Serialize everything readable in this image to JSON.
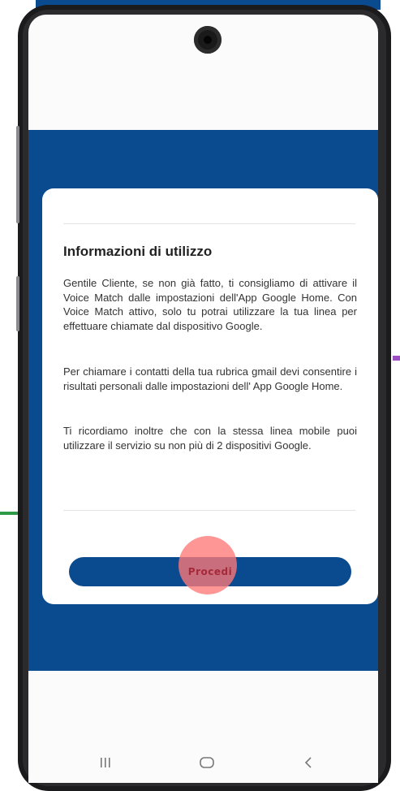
{
  "card": {
    "title": "Informazioni di utilizzo",
    "paragraphs": [
      "Gentile Cliente, se non già fatto, ti consigliamo di attivare il Voice Match dalle impostazioni dell'App Google Home. Con Voice Match attivo, solo tu potrai utilizzare la tua linea per effettuare chiamate dal dispositivo Google.",
      "Per chiamare i contatti della tua rubrica gmail devi consentire i risultati personali dalle impostazioni dell' App Google Home.",
      "Ti ricordiamo inoltre che con la stessa linea mobile puoi utilizzare il servizio su non più di 2 dispositivi Google."
    ],
    "button_label": "Procedi"
  },
  "navbar": {
    "recents_icon": "recents-icon",
    "home_icon": "home-icon",
    "back_icon": "back-icon"
  },
  "colors": {
    "brand_blue": "#0a4a8f",
    "tap_indicator": "#ff7878",
    "card_background": "#ffffff"
  }
}
